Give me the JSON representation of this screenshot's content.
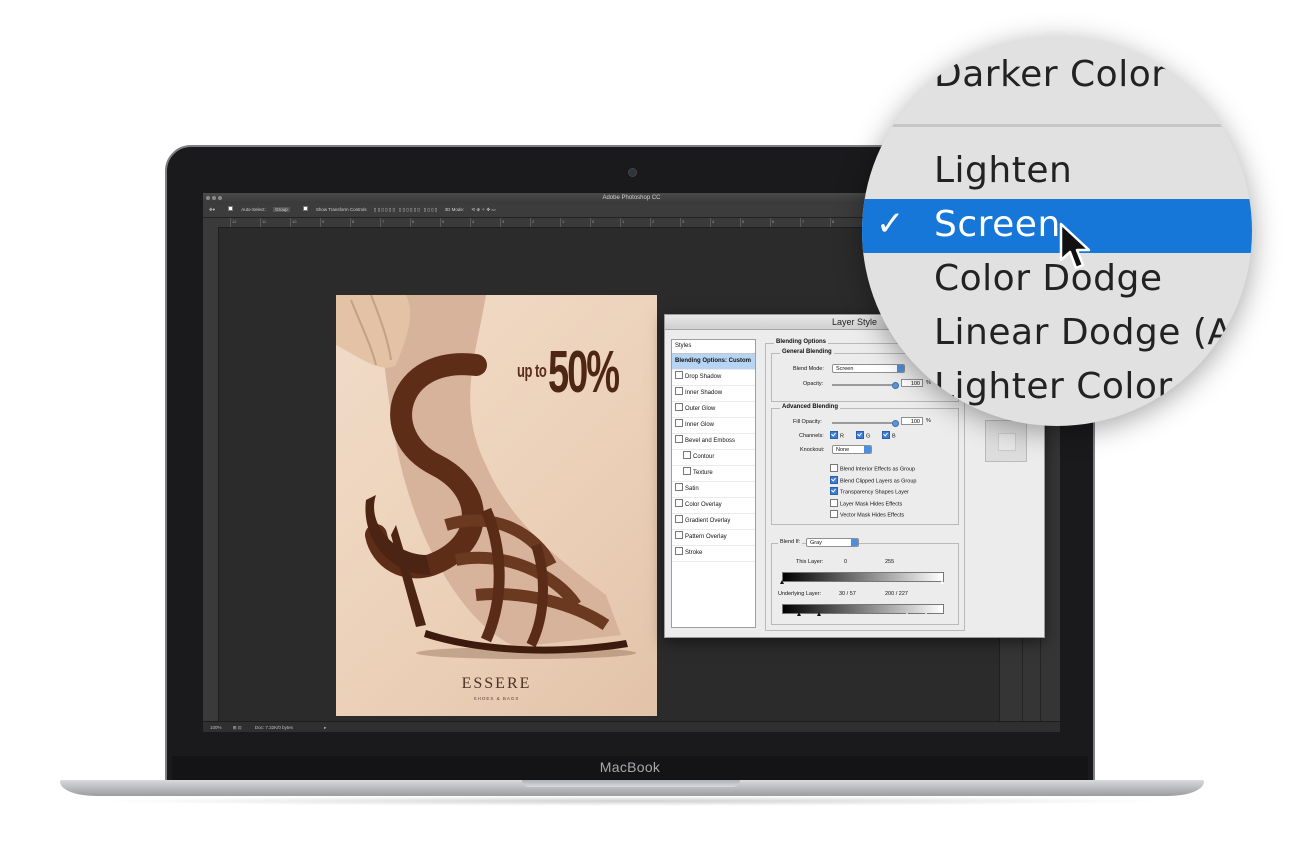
{
  "window": {
    "title": "Adobe Photoshop CC"
  },
  "options_bar": {
    "auto_select_label": "Auto-Select:",
    "auto_select_value": "Group",
    "show_transform_label": "Show Transform Controls",
    "mode_label": "3D Mode:"
  },
  "ruler": {
    "ticks": [
      "12",
      "11",
      "10",
      "9",
      "8",
      "7",
      "6",
      "5",
      "4",
      "3",
      "2",
      "1",
      "0",
      "1",
      "2",
      "3",
      "4",
      "5",
      "6",
      "7",
      "8"
    ]
  },
  "status_bar": {
    "zoom": "100%",
    "doc": "Doc: 7.32K/0 bytes"
  },
  "poster": {
    "upto": "up to",
    "percent": "50%",
    "brand": "ESSERE",
    "tagline": "SHOES & BAGS"
  },
  "dialog": {
    "title": "Layer Style",
    "styles_header": "Styles",
    "styles": [
      {
        "label": "Blending Options: Custom",
        "selected": true,
        "checkbox": false
      },
      {
        "label": "Drop Shadow",
        "checkbox": true,
        "checked": false
      },
      {
        "label": "Inner Shadow",
        "checkbox": true,
        "checked": false
      },
      {
        "label": "Outer Glow",
        "checkbox": true,
        "checked": false
      },
      {
        "label": "Inner Glow",
        "checkbox": true,
        "checked": false
      },
      {
        "label": "Bevel and Emboss",
        "checkbox": true,
        "checked": false
      },
      {
        "label": "Contour",
        "checkbox": true,
        "checked": false,
        "indent": true
      },
      {
        "label": "Texture",
        "checkbox": true,
        "checked": false,
        "indent": true
      },
      {
        "label": "Satin",
        "checkbox": true,
        "checked": false
      },
      {
        "label": "Color Overlay",
        "checkbox": true,
        "checked": false
      },
      {
        "label": "Gradient Overlay",
        "checkbox": true,
        "checked": false
      },
      {
        "label": "Pattern Overlay",
        "checkbox": true,
        "checked": false
      },
      {
        "label": "Stroke",
        "checkbox": true,
        "checked": false
      }
    ],
    "blending_options_legend": "Blending Options",
    "general_legend": "General Blending",
    "blend_mode_label": "Blend Mode:",
    "blend_mode_value": "Screen",
    "opacity_label": "Opacity:",
    "opacity_value": "100",
    "percent_sign": "%",
    "advanced_legend": "Advanced Blending",
    "fill_opacity_label": "Fill Opacity:",
    "fill_opacity_value": "100",
    "channels_label": "Channels:",
    "channel_r": "R",
    "channel_g": "G",
    "channel_b": "B",
    "knockout_label": "Knockout:",
    "knockout_value": "None",
    "options": [
      {
        "label": "Blend Interior Effects as Group",
        "checked": false
      },
      {
        "label": "Blend Clipped Layers as Group",
        "checked": true
      },
      {
        "label": "Transparency Shapes Layer",
        "checked": true
      },
      {
        "label": "Layer Mask Hides Effects",
        "checked": false
      },
      {
        "label": "Vector Mask Hides Effects",
        "checked": false
      }
    ],
    "blend_if_label": "Blend If:",
    "blend_if_value": "Gray",
    "this_layer_label": "This Layer:",
    "this_layer_low": "0",
    "this_layer_high": "255",
    "underlying_label": "Underlying Layer:",
    "underlying_low": "30  /  57",
    "underlying_high": "200  /  227"
  },
  "magnifier": {
    "items": [
      "Darker Color",
      "Lighten",
      "Screen",
      "Color Dodge",
      "Linear Dodge (Add)",
      "Lighter Color"
    ],
    "selected": "Screen",
    "check": "✓"
  },
  "laptop": {
    "label": "MacBook"
  },
  "colors": {
    "highlight": "#1677d9",
    "accent": "#3d7ed8",
    "poster_brown": "#4e2616"
  }
}
